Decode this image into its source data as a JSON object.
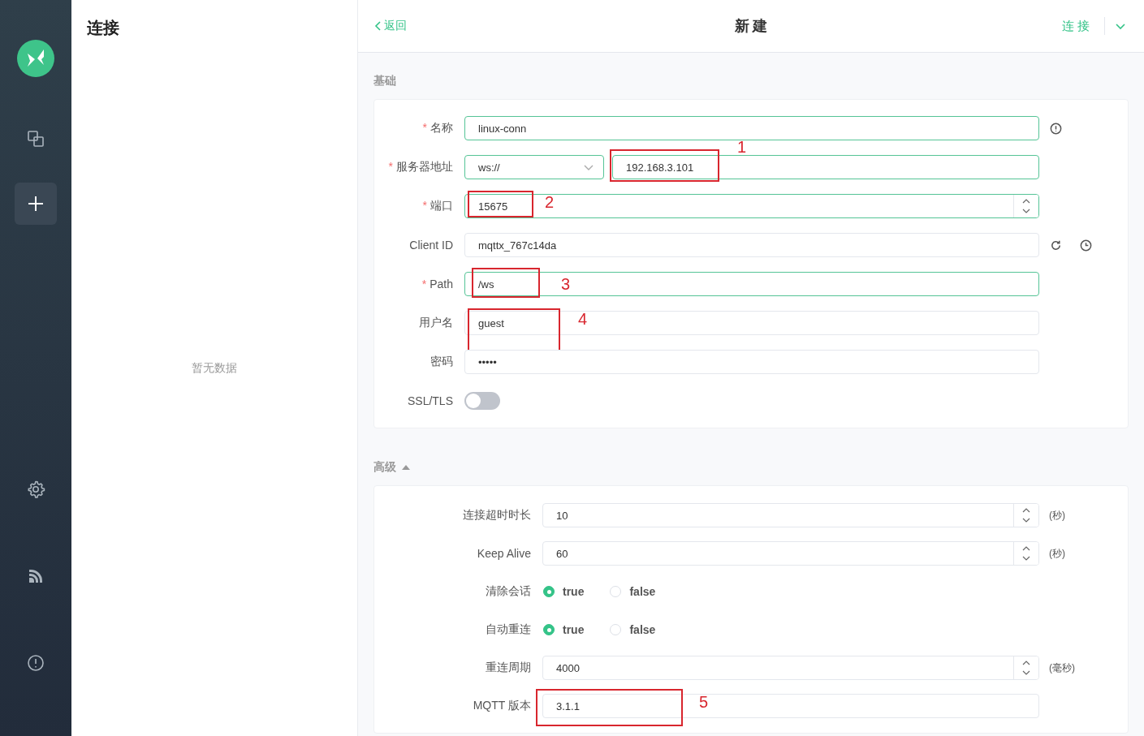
{
  "rail": {
    "top": [
      {
        "kind": "logo"
      },
      {
        "kind": "connections",
        "selected": false
      },
      {
        "kind": "new",
        "selected": true
      }
    ],
    "bottom": [
      {
        "kind": "settings",
        "selected": false
      },
      {
        "kind": "log",
        "selected": false
      },
      {
        "kind": "about",
        "selected": false
      }
    ]
  },
  "connections_panel": {
    "title": "连接",
    "empty_text": "暂无数据"
  },
  "header": {
    "back": "返回",
    "title": "新建",
    "connect": "连接"
  },
  "basic": {
    "title": "基础",
    "fields": [
      {
        "kind": "text",
        "required_mark": "*",
        "label": "名称",
        "value": "linux-conn",
        "actions": [
          {
            "kind": "info"
          }
        ]
      },
      {
        "kind": "host",
        "required_mark": "*",
        "label": "服务器地址",
        "protocol": "ws://",
        "value": "192.168.3.101",
        "annotation": "1"
      },
      {
        "kind": "number",
        "required_mark": "*",
        "label": "端口",
        "value": "15675",
        "annotation": "2"
      },
      {
        "kind": "text",
        "label": "Client ID",
        "value": "mqttx_767c14da",
        "actions": [
          {
            "kind": "refresh"
          },
          {
            "kind": "history"
          }
        ]
      },
      {
        "kind": "text",
        "required_mark": "*",
        "label": "Path",
        "value": "/ws",
        "annotation": "3"
      },
      {
        "kind": "text",
        "label": "用户名",
        "value": "guest",
        "annotation": "4"
      },
      {
        "kind": "text",
        "label": "密码",
        "value": "•••••"
      },
      {
        "kind": "toggle",
        "label": "SSL/TLS",
        "on": false
      }
    ]
  },
  "advanced": {
    "title": "高级",
    "expanded": true,
    "fields": [
      {
        "kind": "number",
        "label": "连接超时时长",
        "value": "10",
        "unit": "(秒)"
      },
      {
        "kind": "number",
        "label": "Keep Alive",
        "value": "60",
        "unit": "(秒)"
      },
      {
        "kind": "radio",
        "label": "清除会话",
        "options": [
          {
            "label": "true",
            "selected": true
          },
          {
            "label": "false",
            "selected": false
          }
        ]
      },
      {
        "kind": "radio",
        "label": "自动重连",
        "options": [
          {
            "label": "true",
            "selected": true
          },
          {
            "label": "false",
            "selected": false
          }
        ]
      },
      {
        "kind": "number",
        "label": "重连周期",
        "value": "4000",
        "unit": "(毫秒)"
      },
      {
        "kind": "text",
        "label": "MQTT 版本",
        "value": "3.1.1",
        "annotation": "5"
      }
    ]
  }
}
